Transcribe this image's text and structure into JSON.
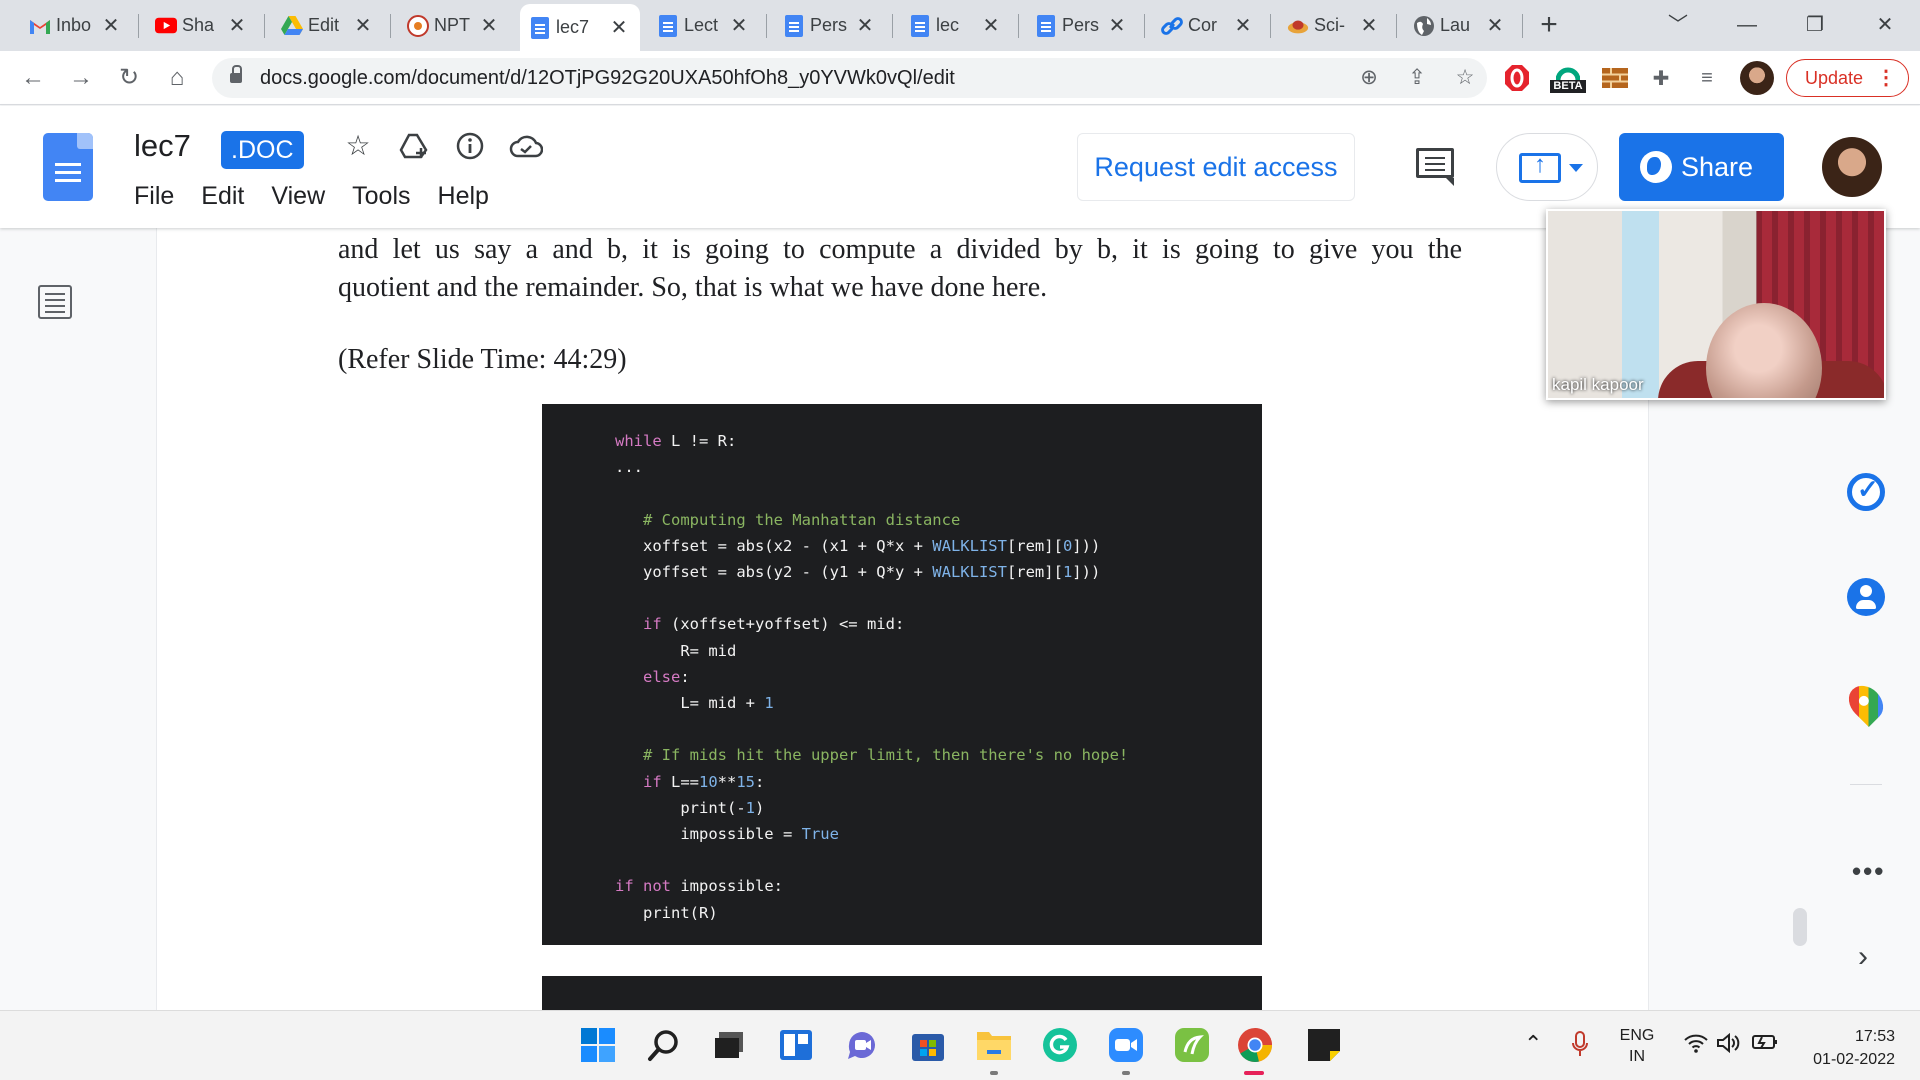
{
  "browser": {
    "tabs": [
      {
        "title": "Inbo",
        "icon": "gmail-icon",
        "active": false
      },
      {
        "title": "Sha",
        "icon": "youtube-icon",
        "active": false
      },
      {
        "title": "Edit",
        "icon": "google-drive-icon",
        "active": false
      },
      {
        "title": "NPT",
        "icon": "nptel-icon",
        "active": false
      },
      {
        "title": "lec7",
        "icon": "google-docs-icon",
        "active": true
      },
      {
        "title": "Lect",
        "icon": "google-docs-icon",
        "active": false
      },
      {
        "title": "Pers",
        "icon": "google-docs-icon",
        "active": false
      },
      {
        "title": "lec",
        "icon": "google-docs-icon",
        "active": false
      },
      {
        "title": "Pers",
        "icon": "google-docs-icon",
        "active": false
      },
      {
        "title": "Cor",
        "icon": "link-icon",
        "active": false
      },
      {
        "title": "Sci-",
        "icon": "scihub-icon",
        "active": false
      },
      {
        "title": "Lau",
        "icon": "globe-icon",
        "active": false
      }
    ],
    "new_tab": "+",
    "url": "docs.google.com/document/d/12OTjPG92G20UXA50hfOh8_y0YVWk0vQl/edit",
    "update_label": "Update",
    "extension_badge": "BETA"
  },
  "docs": {
    "title": "lec7",
    "badge": ".DOC",
    "menu": [
      "File",
      "Edit",
      "View",
      "Tools",
      "Help"
    ],
    "request_edit_label": "Request edit access",
    "share_label": "Share"
  },
  "document": {
    "para1": "and let us say a and b, it is going to compute a divided by b, it is going to give you the",
    "para2": "quotient and the remainder. So, that is what we have done here.",
    "para3": "(Refer Slide Time: 44:29)"
  },
  "video": {
    "participant_name": "kapil kapoor"
  },
  "taskbar": {
    "lang_line1": "ENG",
    "lang_line2": "IN",
    "time": "17:53",
    "date": "01-02-2022"
  },
  "colors": {
    "accent": "#1a73e8",
    "update_red": "#d93025",
    "code_bg": "#1d1e20"
  }
}
